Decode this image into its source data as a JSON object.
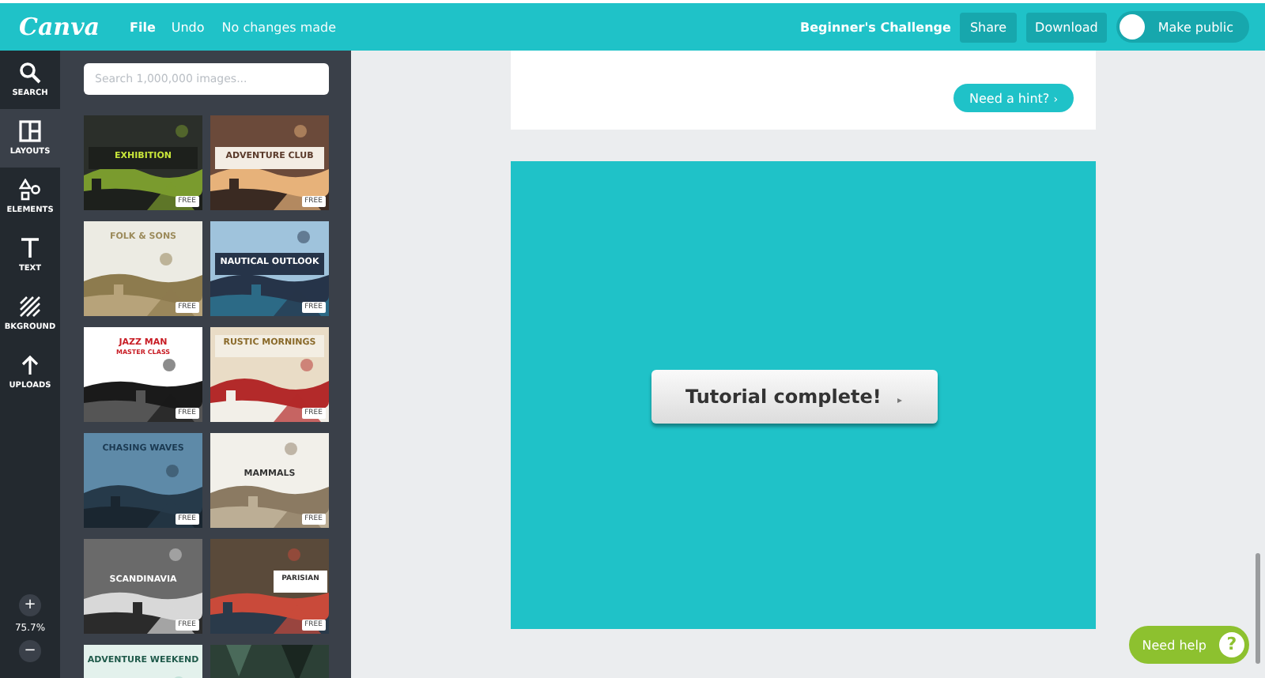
{
  "topbar": {
    "logo": "Canva",
    "menu": [
      "File",
      "Undo"
    ],
    "status": "No changes made",
    "title": "Beginner's Challenge",
    "buttons": [
      "Share",
      "Download"
    ],
    "public_toggle": {
      "label": "Make public",
      "on": false
    }
  },
  "rail": {
    "items": [
      {
        "kind": "search",
        "label": "SEARCH",
        "selected": false
      },
      {
        "kind": "layouts",
        "label": "LAYOUTS",
        "selected": true
      },
      {
        "kind": "elements",
        "label": "ELEMENTS",
        "selected": false
      },
      {
        "kind": "text",
        "label": "TEXT",
        "selected": false
      },
      {
        "kind": "background",
        "label": "BKGROUND",
        "selected": false
      },
      {
        "kind": "uploads",
        "label": "UPLOADS",
        "selected": false
      }
    ],
    "zoom_in": "+",
    "zoom_level": "75.7%",
    "zoom_out": "−"
  },
  "panel": {
    "search": {
      "placeholder": "Search 1,000,000 images..."
    },
    "layouts": [
      {
        "title": "EXHIBITION",
        "badge": "FREE"
      },
      {
        "title": "ADVENTURE CLUB",
        "badge": "FREE"
      },
      {
        "title": "FOLK & SONS",
        "badge": "FREE"
      },
      {
        "title": "NAUTICAL OUTLOOK",
        "badge": "FREE"
      },
      {
        "title": "JAZZ MAN",
        "subtitle": "MASTER CLASS",
        "badge": "FREE"
      },
      {
        "title": "RUSTIC MORNINGS",
        "badge": "FREE"
      },
      {
        "title": "CHASING WAVES",
        "badge": "FREE"
      },
      {
        "title": "MAMMALS",
        "badge": "FREE"
      },
      {
        "title": "SCANDINAVIA",
        "badge": "FREE"
      },
      {
        "title": "PARISIAN",
        "badge": "FREE"
      },
      {
        "title": "ADVENTURE WEEKEND"
      },
      {
        "kind": "picture"
      }
    ]
  },
  "canvas": {
    "hint_button": "Need a hint?",
    "hint_arrow": "›",
    "action_button": "Tutorial complete!",
    "action_arrow": "▸"
  },
  "help_button": {
    "label": "Need help",
    "icon": "?"
  }
}
